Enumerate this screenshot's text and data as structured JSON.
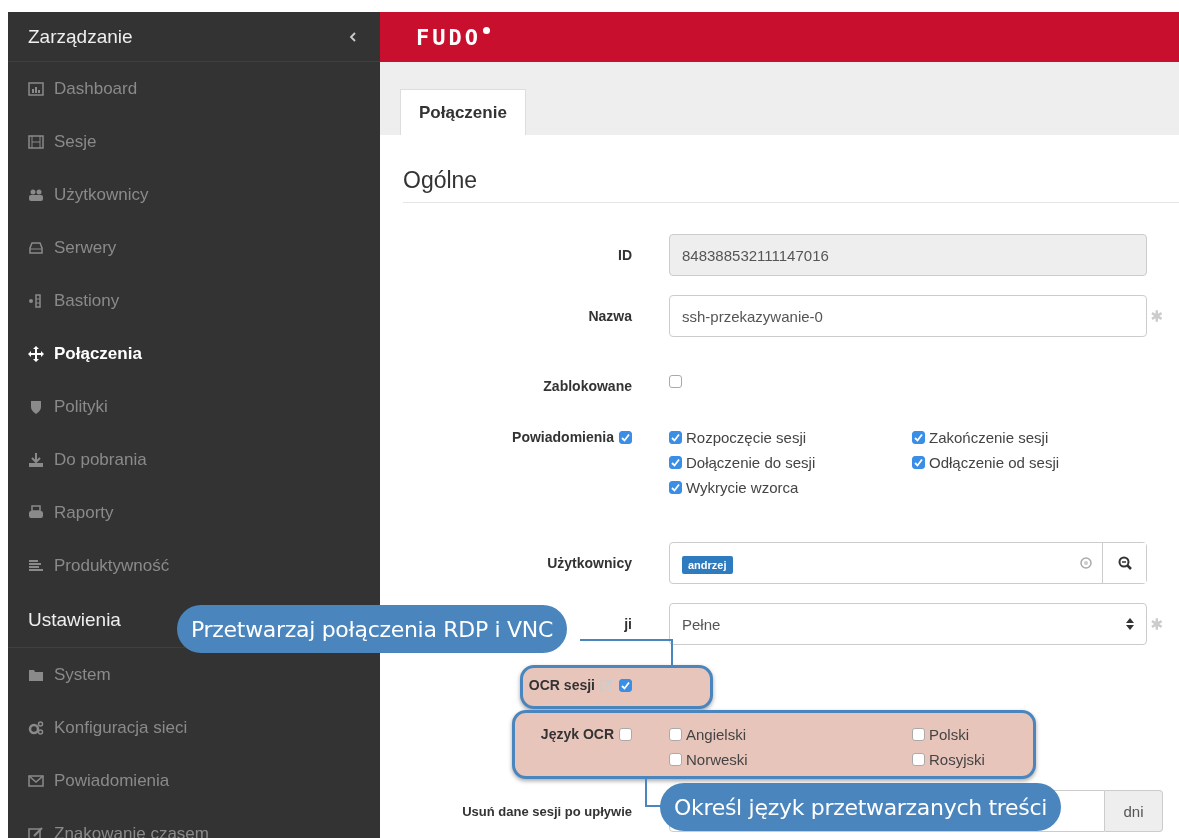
{
  "sidebar": {
    "sections": [
      {
        "title": "Zarządzanie",
        "items": [
          {
            "label": "Dashboard",
            "selected": false
          },
          {
            "label": "Sesje",
            "selected": false
          },
          {
            "label": "Użytkownicy",
            "selected": false
          },
          {
            "label": "Serwery",
            "selected": false
          },
          {
            "label": "Bastiony",
            "selected": false
          },
          {
            "label": "Połączenia",
            "selected": true
          },
          {
            "label": "Polityki",
            "selected": false
          },
          {
            "label": "Do pobrania",
            "selected": false
          },
          {
            "label": "Raporty",
            "selected": false
          },
          {
            "label": "Produktywność",
            "selected": false
          }
        ]
      },
      {
        "title": "Ustawienia",
        "items": [
          {
            "label": "System",
            "selected": false
          },
          {
            "label": "Konfiguracja sieci",
            "selected": false
          },
          {
            "label": "Powiadomienia",
            "selected": false
          },
          {
            "label": "Znakowanie czasem",
            "selected": false
          }
        ]
      }
    ]
  },
  "header": {
    "logo": "FUDO"
  },
  "tabs": [
    {
      "label": "Połączenie",
      "selected": true
    }
  ],
  "section_title": "Ogólne",
  "fields": [
    {
      "kind": "text",
      "label": "ID",
      "value": "848388532111147016",
      "disabled": true,
      "required": false
    },
    {
      "kind": "text",
      "label": "Nazwa",
      "value": "ssh-przekazywanie-0",
      "disabled": false,
      "required": true
    },
    {
      "kind": "checkbox",
      "label": "Zablokowane",
      "checked": false,
      "highlighted": false
    },
    {
      "kind": "checkgroup",
      "label": "Powiadomienia",
      "checked": true,
      "highlighted": false,
      "options": [
        {
          "label": "Rozpoczęcie sesji",
          "checked": true
        },
        {
          "label": "Zakończenie sesji",
          "checked": true
        },
        {
          "label": "Dołączenie do sesji",
          "checked": true
        },
        {
          "label": "Odłączenie od sesji",
          "checked": true
        },
        {
          "label": "Wykrycie wzorca",
          "checked": true
        }
      ]
    },
    {
      "kind": "tags",
      "label": "Użytkownicy",
      "tags": [
        "andrzej"
      ]
    },
    {
      "kind": "select",
      "label": "ji",
      "value": "Pełne",
      "required": true
    },
    {
      "kind": "checkbox",
      "label": "OCR sesji",
      "checked": true,
      "highlighted": true
    },
    {
      "kind": "checkgroup",
      "label": "Język OCR",
      "checked": false,
      "highlighted": true,
      "options": [
        {
          "label": "Angielski",
          "checked": false
        },
        {
          "label": "Polski",
          "checked": false
        },
        {
          "label": "Norweski",
          "checked": false
        },
        {
          "label": "Rosyjski",
          "checked": false
        }
      ]
    },
    {
      "kind": "addon",
      "label": "Usuń dane sesji po upływie",
      "addon": "dni"
    }
  ],
  "callouts": [
    {
      "text": "Przetwarzaj połączenia RDP i VNC"
    },
    {
      "text": "Określ język przetwarzanych treści"
    }
  ]
}
